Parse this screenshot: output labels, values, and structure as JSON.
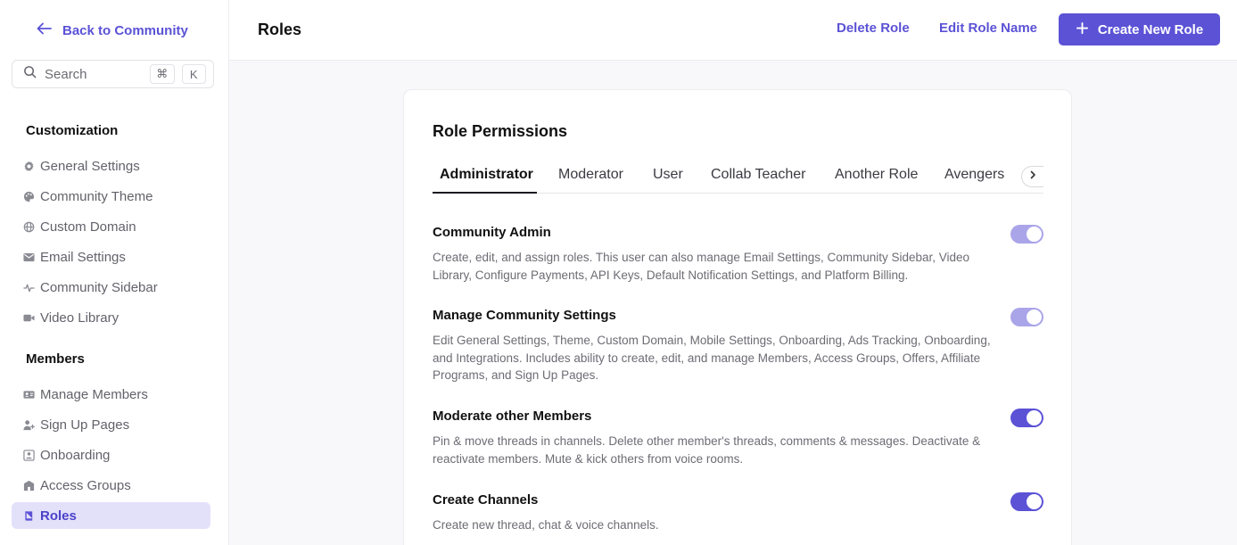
{
  "sidebar": {
    "back_label": "Back to Community",
    "search_placeholder": "Search",
    "shortcut_keys": [
      "⌘",
      "K"
    ],
    "sections": [
      {
        "title": "Customization",
        "items": [
          {
            "label": "General Settings",
            "icon": "gear-icon"
          },
          {
            "label": "Community Theme",
            "icon": "palette-icon"
          },
          {
            "label": "Custom Domain",
            "icon": "globe-icon"
          },
          {
            "label": "Email Settings",
            "icon": "envelope-icon"
          },
          {
            "label": "Community Sidebar",
            "icon": "pulse-icon"
          },
          {
            "label": "Video Library",
            "icon": "video-icon"
          }
        ]
      },
      {
        "title": "Members",
        "items": [
          {
            "label": "Manage Members",
            "icon": "id-card-icon"
          },
          {
            "label": "Sign Up Pages",
            "icon": "user-plus-icon"
          },
          {
            "label": "Onboarding",
            "icon": "onboarding-icon"
          },
          {
            "label": "Access Groups",
            "icon": "building-icon"
          },
          {
            "label": "Roles",
            "icon": "book-icon",
            "active": true
          }
        ]
      }
    ]
  },
  "header": {
    "title": "Roles",
    "delete_label": "Delete Role",
    "edit_label": "Edit Role Name",
    "create_label": "Create New Role"
  },
  "card": {
    "title": "Role Permissions",
    "tabs": [
      "Administrator",
      "Moderator",
      "User",
      "Collab Teacher",
      "Another Role",
      "Avengers"
    ],
    "active_tab": "Administrator",
    "permissions": [
      {
        "title": "Community Admin",
        "description": "Create, edit, and assign roles. This user can also manage Email Settings, Community Sidebar, Video Library, Configure Payments, API Keys, Default Notification Settings, and Platform Billing.",
        "enabled": true,
        "locked": true
      },
      {
        "title": "Manage Community Settings",
        "description": "Edit General Settings, Theme, Custom Domain, Mobile Settings, Onboarding, Ads Tracking, Onboarding, and Integrations. Includes ability to create, edit, and manage Members, Access Groups, Offers, Affiliate Programs, and Sign Up Pages.",
        "enabled": true,
        "locked": true
      },
      {
        "title": "Moderate other Members",
        "description": "Pin & move threads in channels. Delete other member's threads, comments & messages. Deactivate & reactivate members. Mute & kick others from voice rooms.",
        "enabled": true,
        "locked": false
      },
      {
        "title": "Create Channels",
        "description": "Create new thread, chat & voice channels.",
        "enabled": true,
        "locked": false
      }
    ]
  },
  "colors": {
    "accent": "#5b52d6",
    "accent_dim": "#aaa5e8",
    "active_nav_bg": "#e3e1fa"
  }
}
